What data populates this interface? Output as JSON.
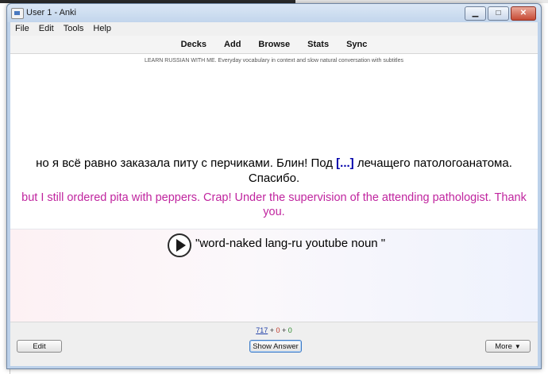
{
  "window": {
    "title": "User 1 - Anki",
    "buttons": {
      "minimize": "▁",
      "maximize": "□",
      "close": "✕"
    }
  },
  "menubar": {
    "items": [
      "File",
      "Edit",
      "Tools",
      "Help"
    ]
  },
  "toolbar": {
    "items": [
      "Decks",
      "Add",
      "Browse",
      "Stats",
      "Sync"
    ]
  },
  "card": {
    "header": "LEARN RUSSIAN WITH ME. Everyday vocabulary in context and slow natural conversation with subtitles",
    "russian_before": "но я всё равно заказала питу с перчиками. Блин! Под ",
    "cloze": "[...]",
    "russian_after": " лечащего патологоанатома. Спасибо.",
    "english": "but I still ordered pita with peppers. Crap! Under the supervision of the attending pathologist. Thank you.",
    "sound_text": "\"word-naked lang-ru youtube noun \""
  },
  "footer": {
    "counts": {
      "new": "717",
      "sep1": " + ",
      "learn": "0",
      "sep2": " + ",
      "review": "0"
    },
    "edit_label": "Edit",
    "show_answer_label": "Show Answer",
    "more_label": "More",
    "more_caret": "▼"
  },
  "icons": {
    "play": "play-icon",
    "app": "anki-icon"
  },
  "colors": {
    "cloze": "#0000aa",
    "english": "#c0259f",
    "count_new": "#1f3fa8",
    "count_learn": "#c0392b",
    "count_review": "#2e8b2e"
  }
}
